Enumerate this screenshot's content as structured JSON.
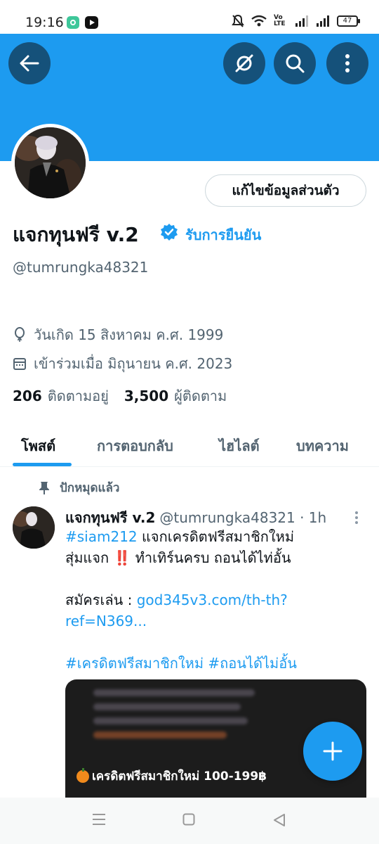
{
  "status_bar": {
    "time": "19:16",
    "battery": "47",
    "network_label": "Vo LTE",
    "icons": [
      "mute-icon",
      "wifi-icon",
      "signal-icon",
      "battery-icon"
    ]
  },
  "header": {
    "back_icon": "arrow-left-icon",
    "actions": [
      "no-audio-icon",
      "search-icon",
      "more-vertical-icon"
    ],
    "banner_color": "#1d9bf0"
  },
  "profile": {
    "edit_button": "แก้ไขข้อมูลส่วนตัว",
    "display_name": "แจกทุนฟรี v.2",
    "verify_link": "รับการยืนยัน",
    "handle": "@tumrungka48321",
    "birthday": "วันเกิด 15 สิงหาคม ค.ศ. 1999",
    "joined": "เข้าร่วมเมื่อ มิถุนายน ค.ศ. 2023",
    "following_count": "206",
    "following_label": "ติดตามอยู่",
    "followers_count": "3,500",
    "followers_label": "ผู้ติดตาม"
  },
  "tabs": [
    {
      "label": "โพสต์",
      "active": true
    },
    {
      "label": "การตอบกลับ",
      "active": false
    },
    {
      "label": "ไฮไลต์",
      "active": false
    },
    {
      "label": "บทความ",
      "active": false
    }
  ],
  "pinned_tweet": {
    "pinned_label": "ปักหมุดแล้ว",
    "name": "แจกทุนฟรี v.2",
    "handle_time": "@tumrungka48321 · 1h",
    "line1_hashtag": "#siam212",
    "line1_text": " แจกเครดิตฟรีสมาชิกใหม่",
    "line2_text": "สุ่มแจก ",
    "line2_bang": "‼️",
    "line2_rest": " ทำเทิร์นครบ ถอนได้ไท่อั้น",
    "line3_label": "สมัครเล่น : ",
    "line3_link": "god345v3.com/th-th?",
    "line4_link": "ref=N369...",
    "line5_hashtags": "#เครดิตฟรีสมาชิกใหม่ #ถอนได้ไม่อั้น",
    "media_caption": "เครดิตฟรีสมาชิกใหม่ 100-199฿"
  },
  "fab": {
    "icon": "plus-icon"
  },
  "nav_bar": {
    "icons": [
      "menu-icon",
      "home-square-icon",
      "back-triangle-icon"
    ]
  },
  "colors": {
    "accent": "#1d9bf0",
    "text": "#0f1419",
    "secondary": "#536471"
  }
}
